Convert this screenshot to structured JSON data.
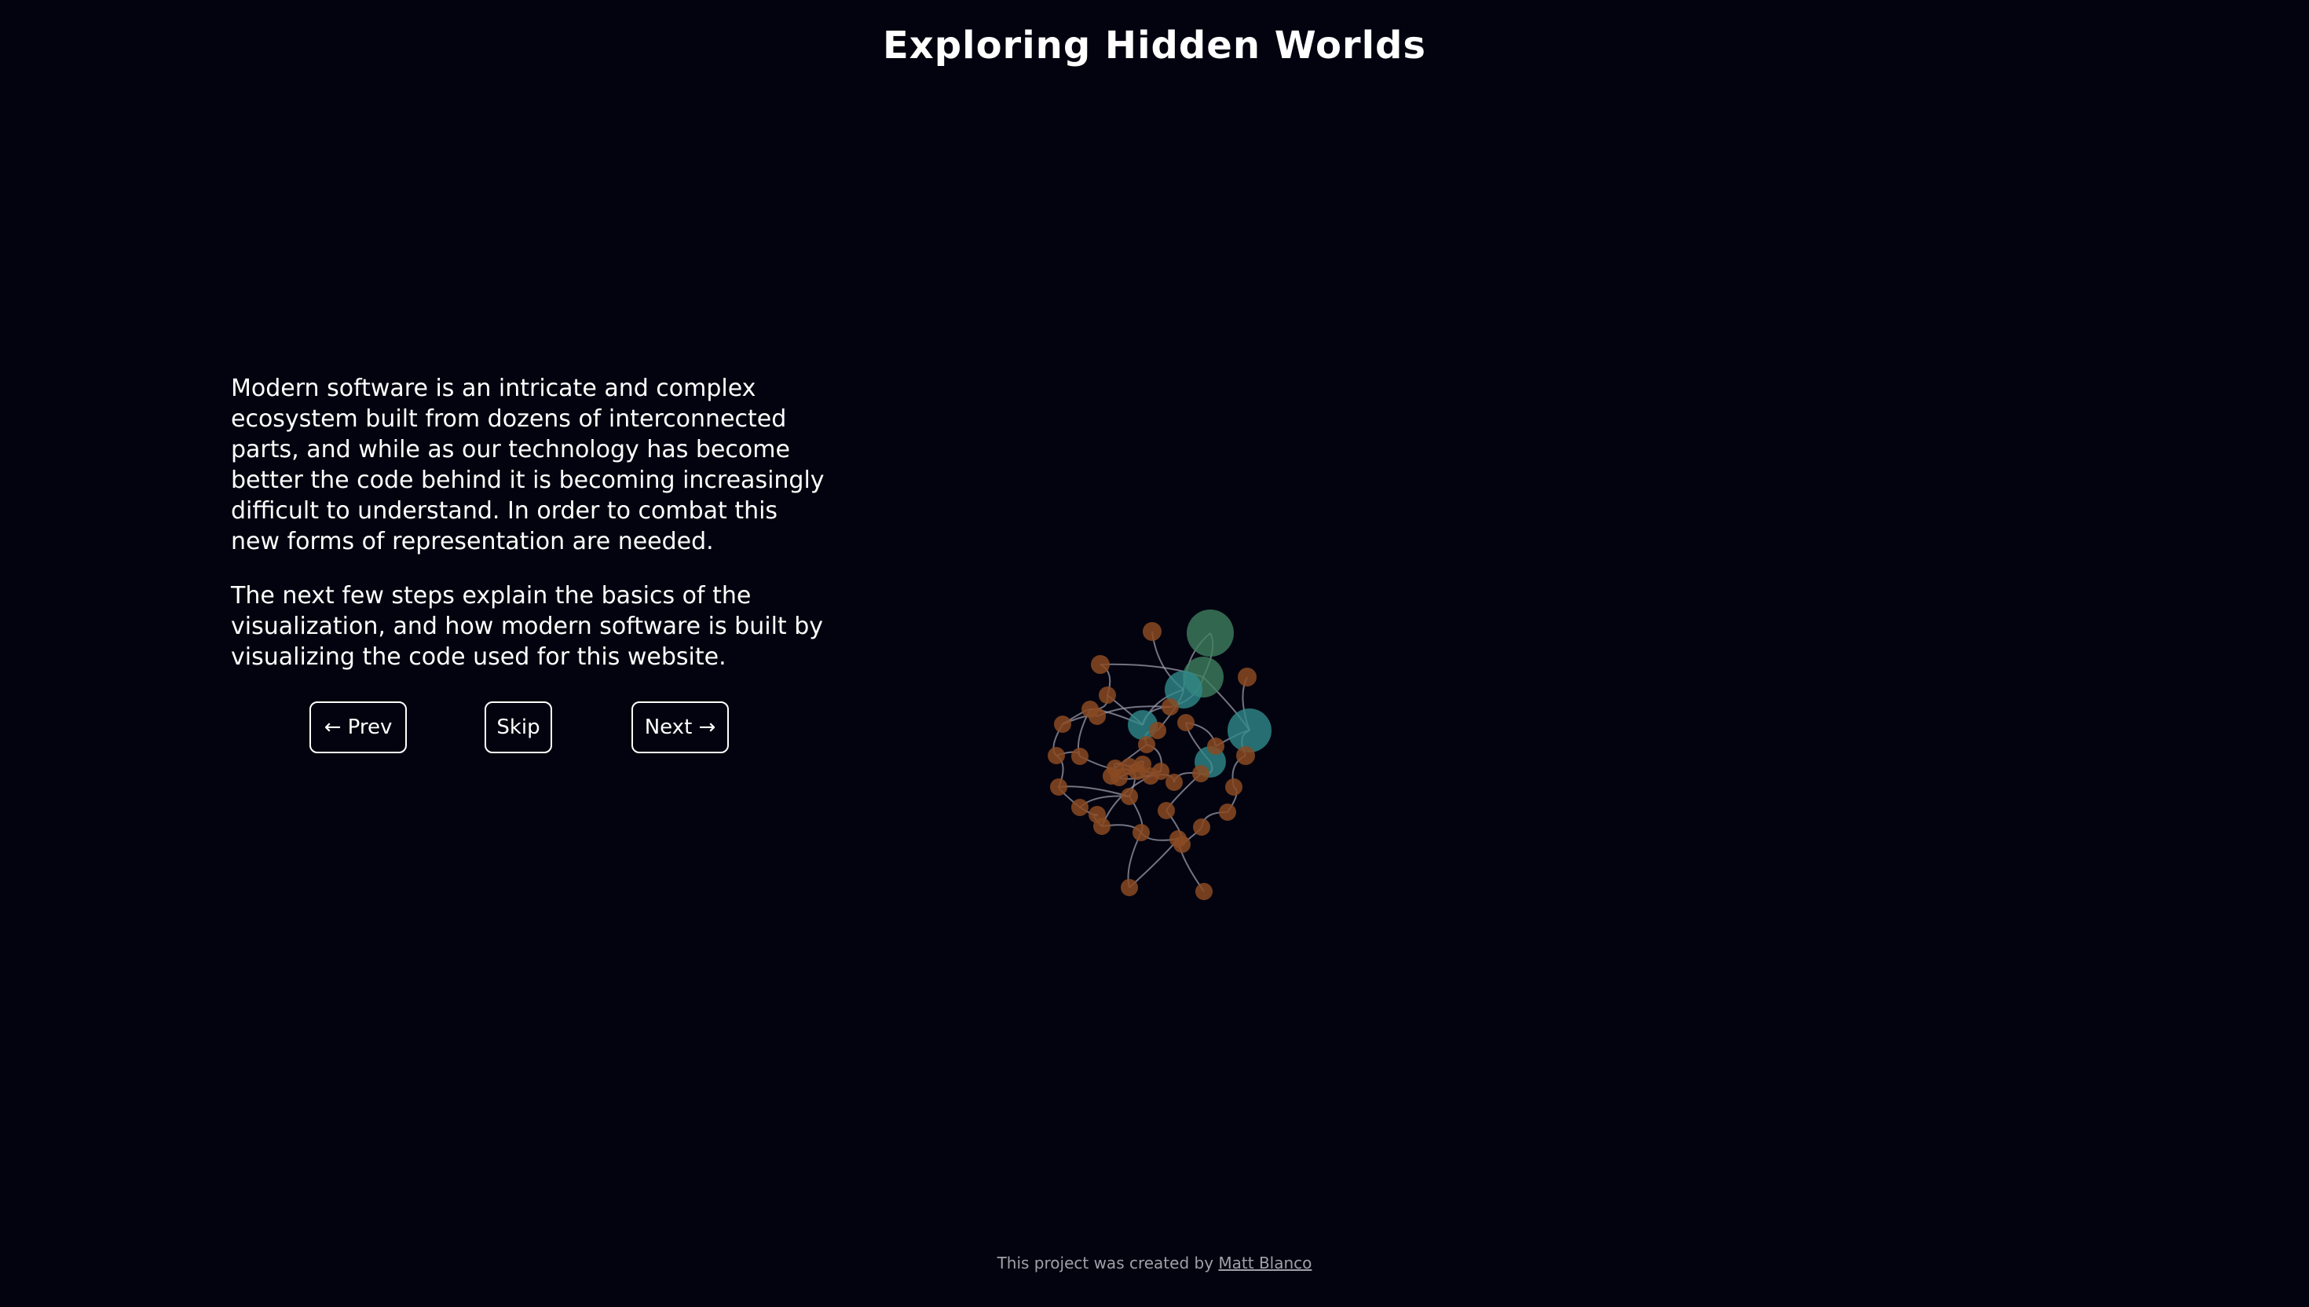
{
  "header": {
    "title": "Exploring Hidden Worlds"
  },
  "intro": {
    "paragraph_1": "Modern software is an intricate and complex ecosystem built from dozens of interconnected parts, and while as our technology has become better the code behind it is becoming increasingly difficult to understand. In order to combat this new forms of representation are needed.",
    "paragraph_2": "The next few steps explain the basics of the visualization, and how modern software is built by visualizing the code used for this website."
  },
  "controls": {
    "prev_label": "← Prev",
    "skip_label": "Skip",
    "next_label": "Next →"
  },
  "footer": {
    "credit_text": "This project was created by ",
    "author_link": "Matt Blanco"
  },
  "colors": {
    "background": "#03030f",
    "text": "#ffffff",
    "footer_text": "#a0a0a8",
    "node_orange": "#8a4a22",
    "node_teal": "#2f8a8a",
    "node_green": "#3f7f5f",
    "link": "#9a9aaa"
  }
}
